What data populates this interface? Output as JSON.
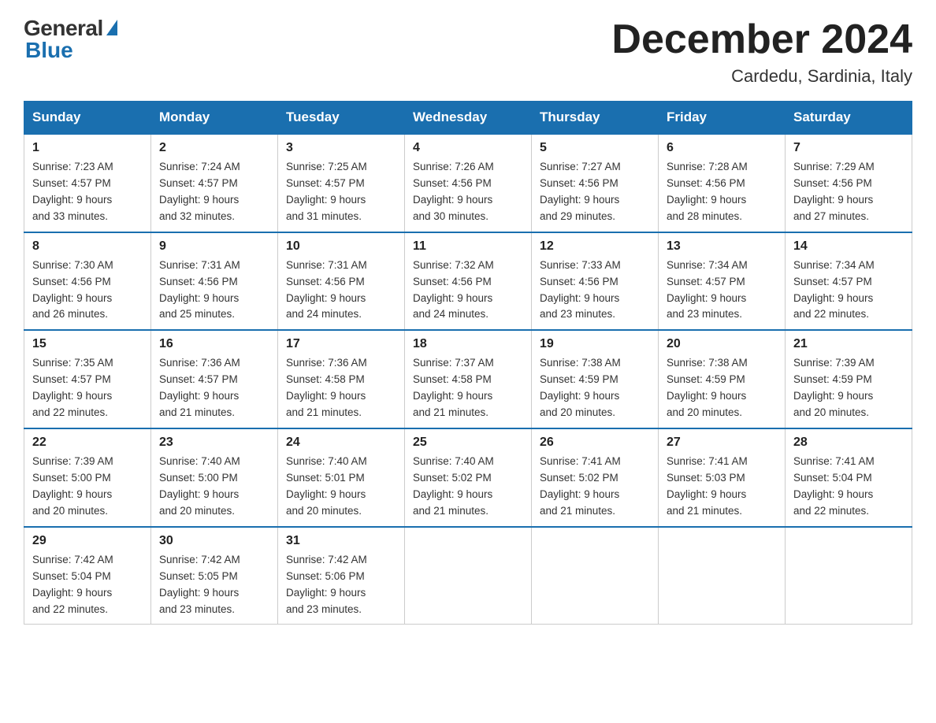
{
  "header": {
    "logo_general": "General",
    "logo_blue": "Blue",
    "month_title": "December 2024",
    "location": "Cardedu, Sardinia, Italy"
  },
  "weekdays": [
    "Sunday",
    "Monday",
    "Tuesday",
    "Wednesday",
    "Thursday",
    "Friday",
    "Saturday"
  ],
  "weeks": [
    [
      {
        "day": "1",
        "sunrise": "7:23 AM",
        "sunset": "4:57 PM",
        "daylight": "9 hours and 33 minutes."
      },
      {
        "day": "2",
        "sunrise": "7:24 AM",
        "sunset": "4:57 PM",
        "daylight": "9 hours and 32 minutes."
      },
      {
        "day": "3",
        "sunrise": "7:25 AM",
        "sunset": "4:57 PM",
        "daylight": "9 hours and 31 minutes."
      },
      {
        "day": "4",
        "sunrise": "7:26 AM",
        "sunset": "4:56 PM",
        "daylight": "9 hours and 30 minutes."
      },
      {
        "day": "5",
        "sunrise": "7:27 AM",
        "sunset": "4:56 PM",
        "daylight": "9 hours and 29 minutes."
      },
      {
        "day": "6",
        "sunrise": "7:28 AM",
        "sunset": "4:56 PM",
        "daylight": "9 hours and 28 minutes."
      },
      {
        "day": "7",
        "sunrise": "7:29 AM",
        "sunset": "4:56 PM",
        "daylight": "9 hours and 27 minutes."
      }
    ],
    [
      {
        "day": "8",
        "sunrise": "7:30 AM",
        "sunset": "4:56 PM",
        "daylight": "9 hours and 26 minutes."
      },
      {
        "day": "9",
        "sunrise": "7:31 AM",
        "sunset": "4:56 PM",
        "daylight": "9 hours and 25 minutes."
      },
      {
        "day": "10",
        "sunrise": "7:31 AM",
        "sunset": "4:56 PM",
        "daylight": "9 hours and 24 minutes."
      },
      {
        "day": "11",
        "sunrise": "7:32 AM",
        "sunset": "4:56 PM",
        "daylight": "9 hours and 24 minutes."
      },
      {
        "day": "12",
        "sunrise": "7:33 AM",
        "sunset": "4:56 PM",
        "daylight": "9 hours and 23 minutes."
      },
      {
        "day": "13",
        "sunrise": "7:34 AM",
        "sunset": "4:57 PM",
        "daylight": "9 hours and 23 minutes."
      },
      {
        "day": "14",
        "sunrise": "7:34 AM",
        "sunset": "4:57 PM",
        "daylight": "9 hours and 22 minutes."
      }
    ],
    [
      {
        "day": "15",
        "sunrise": "7:35 AM",
        "sunset": "4:57 PM",
        "daylight": "9 hours and 22 minutes."
      },
      {
        "day": "16",
        "sunrise": "7:36 AM",
        "sunset": "4:57 PM",
        "daylight": "9 hours and 21 minutes."
      },
      {
        "day": "17",
        "sunrise": "7:36 AM",
        "sunset": "4:58 PM",
        "daylight": "9 hours and 21 minutes."
      },
      {
        "day": "18",
        "sunrise": "7:37 AM",
        "sunset": "4:58 PM",
        "daylight": "9 hours and 21 minutes."
      },
      {
        "day": "19",
        "sunrise": "7:38 AM",
        "sunset": "4:59 PM",
        "daylight": "9 hours and 20 minutes."
      },
      {
        "day": "20",
        "sunrise": "7:38 AM",
        "sunset": "4:59 PM",
        "daylight": "9 hours and 20 minutes."
      },
      {
        "day": "21",
        "sunrise": "7:39 AM",
        "sunset": "4:59 PM",
        "daylight": "9 hours and 20 minutes."
      }
    ],
    [
      {
        "day": "22",
        "sunrise": "7:39 AM",
        "sunset": "5:00 PM",
        "daylight": "9 hours and 20 minutes."
      },
      {
        "day": "23",
        "sunrise": "7:40 AM",
        "sunset": "5:00 PM",
        "daylight": "9 hours and 20 minutes."
      },
      {
        "day": "24",
        "sunrise": "7:40 AM",
        "sunset": "5:01 PM",
        "daylight": "9 hours and 20 minutes."
      },
      {
        "day": "25",
        "sunrise": "7:40 AM",
        "sunset": "5:02 PM",
        "daylight": "9 hours and 21 minutes."
      },
      {
        "day": "26",
        "sunrise": "7:41 AM",
        "sunset": "5:02 PM",
        "daylight": "9 hours and 21 minutes."
      },
      {
        "day": "27",
        "sunrise": "7:41 AM",
        "sunset": "5:03 PM",
        "daylight": "9 hours and 21 minutes."
      },
      {
        "day": "28",
        "sunrise": "7:41 AM",
        "sunset": "5:04 PM",
        "daylight": "9 hours and 22 minutes."
      }
    ],
    [
      {
        "day": "29",
        "sunrise": "7:42 AM",
        "sunset": "5:04 PM",
        "daylight": "9 hours and 22 minutes."
      },
      {
        "day": "30",
        "sunrise": "7:42 AM",
        "sunset": "5:05 PM",
        "daylight": "9 hours and 23 minutes."
      },
      {
        "day": "31",
        "sunrise": "7:42 AM",
        "sunset": "5:06 PM",
        "daylight": "9 hours and 23 minutes."
      },
      null,
      null,
      null,
      null
    ]
  ],
  "labels": {
    "sunrise": "Sunrise:",
    "sunset": "Sunset:",
    "daylight": "Daylight:"
  }
}
